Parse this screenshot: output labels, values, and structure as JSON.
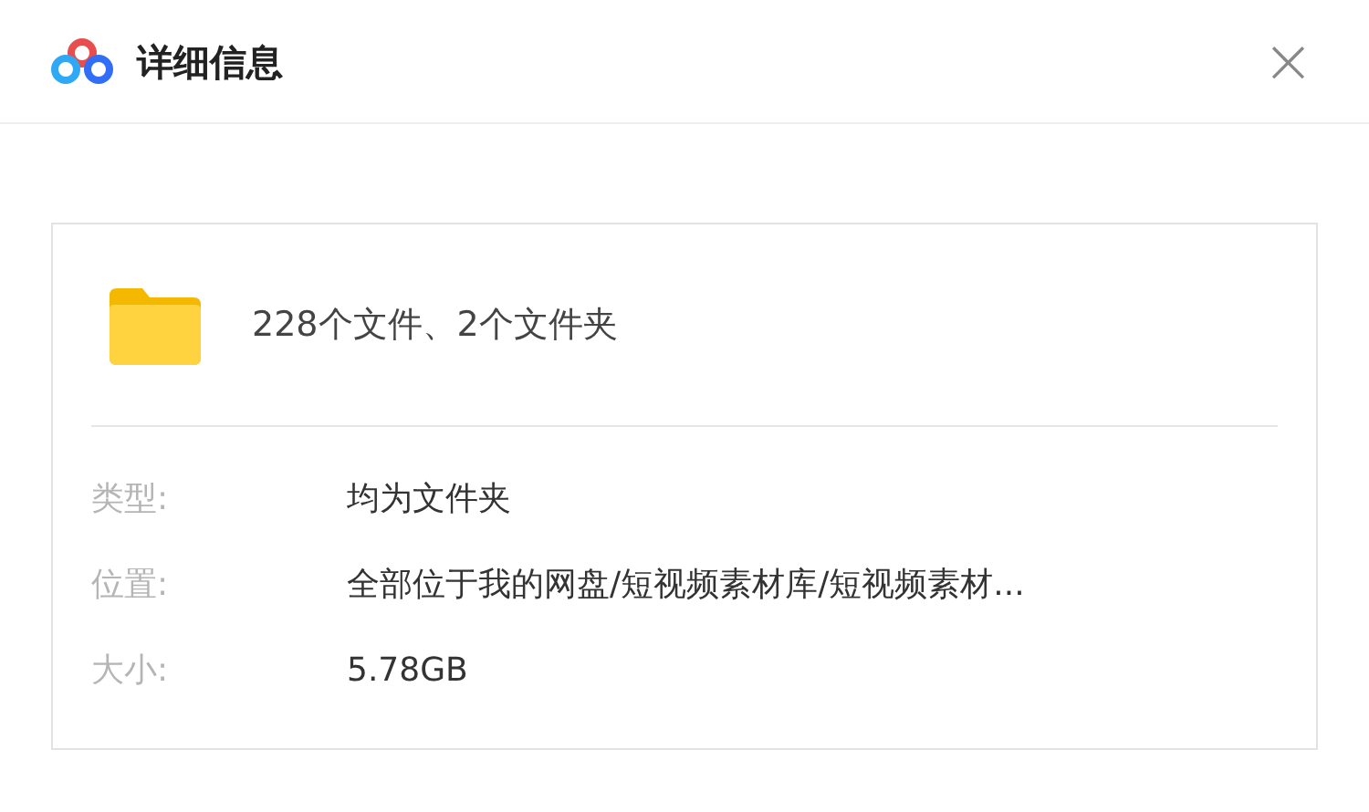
{
  "window": {
    "title": "详细信息",
    "close": "×"
  },
  "summary": "228个文件、2个文件夹",
  "details": [
    {
      "label": "类型:",
      "value": "均为文件夹"
    },
    {
      "label": "位置:",
      "value": "全部位于我的网盘/短视频素材库/短视频素材..."
    },
    {
      "label": "大小:",
      "value": "5.78GB"
    }
  ]
}
